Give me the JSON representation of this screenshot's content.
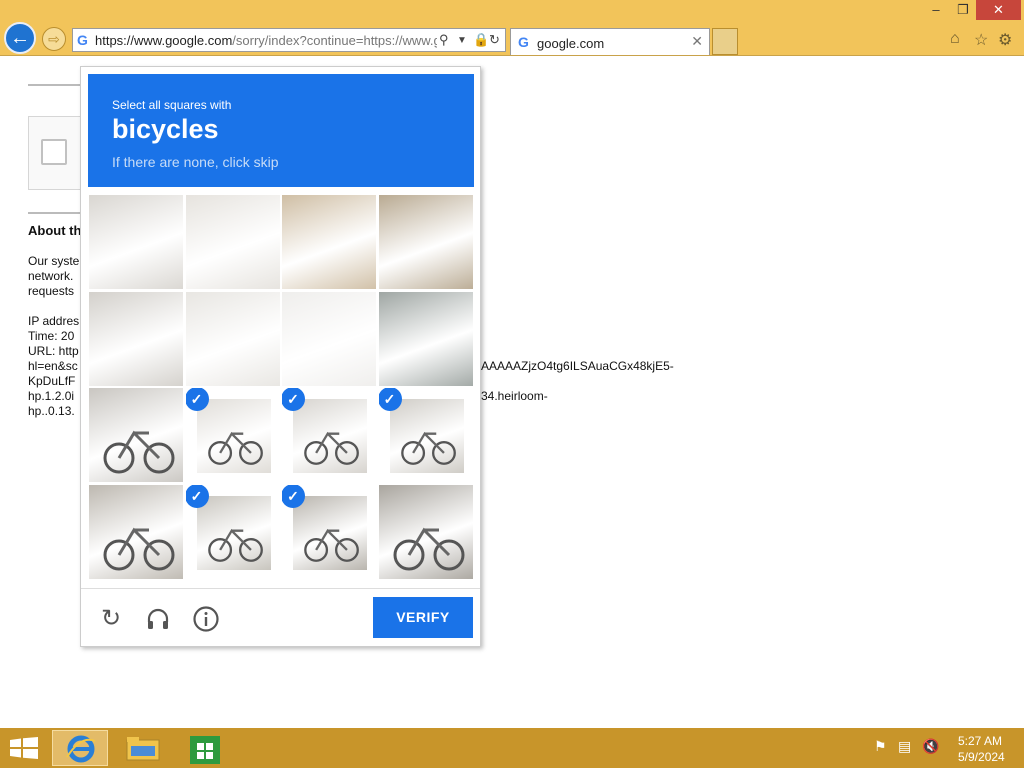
{
  "window": {
    "minimize": "‒",
    "restore": "❐",
    "close": "✕"
  },
  "addressbar": {
    "url_main": "https://www.google.com",
    "url_rest": "/sorry/index?continue=https://www.gc"
  },
  "tab": {
    "title": "google.com",
    "close": "✕"
  },
  "page": {
    "about_heading": "About th",
    "text_lines": [
      "Our syste",
      "network.",
      "requests"
    ],
    "ip_label": "IP addres",
    "time_label": "Time: 20",
    "url_label": "URL: http",
    "url_line2": "hl=en&sc",
    "url_line3": "KpDuLfF",
    "url_line4": "hp.1.2.0i",
    "url_line5": "hp..0.13.",
    "right_line1": "AAAAAZjzO4tg6ILSAuaCGx48kjE5-",
    "right_line2": "34.heirloom-"
  },
  "captcha": {
    "instruction": "Select all squares with",
    "target": "bicycles",
    "hint": "If there are none, click skip",
    "tiles": [
      {
        "selected": false
      },
      {
        "selected": false
      },
      {
        "selected": false
      },
      {
        "selected": false
      },
      {
        "selected": false
      },
      {
        "selected": false
      },
      {
        "selected": false
      },
      {
        "selected": false
      },
      {
        "selected": false
      },
      {
        "selected": true
      },
      {
        "selected": true
      },
      {
        "selected": true
      },
      {
        "selected": false
      },
      {
        "selected": true
      },
      {
        "selected": true
      },
      {
        "selected": false
      }
    ],
    "verify_label": "VERIFY"
  },
  "taskbar": {
    "time": "5:27 AM",
    "date": "5/9/2024"
  },
  "colors": {
    "accent": "#1a73e8",
    "chrome": "#f2c45a",
    "taskbar": "#c8952a"
  }
}
